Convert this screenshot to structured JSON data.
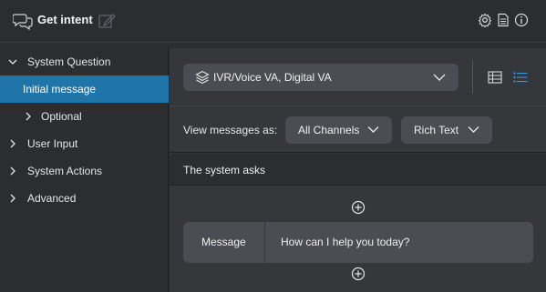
{
  "header": {
    "title": "Get intent",
    "icons": [
      "chat-bubbles-icon",
      "edit-icon",
      "gear-icon",
      "document-icon",
      "info-icon"
    ]
  },
  "sidebar": {
    "items": [
      {
        "label": "System Question",
        "expanded": true
      },
      {
        "label": "Initial message",
        "selected": true
      },
      {
        "label": "Optional",
        "expanded": false
      },
      {
        "label": "User Input",
        "expanded": false
      },
      {
        "label": "System Actions",
        "expanded": false
      },
      {
        "label": "Advanced",
        "expanded": false
      }
    ]
  },
  "main": {
    "environment_select": {
      "value": "IVR/Voice VA, Digital VA"
    },
    "view_toggle": {
      "options": [
        "grid-icon",
        "list-icon"
      ],
      "active": "list-icon"
    },
    "view_messages": {
      "label": "View messages as:",
      "channel_select": "All Channels",
      "format_select": "Rich Text"
    },
    "section": {
      "title": "The system asks"
    },
    "messages": [
      {
        "type": "Message",
        "text": "How can I help you today?"
      }
    ]
  },
  "colors": {
    "background": "#2b2d30",
    "panel": "#35373b",
    "control": "#4a4d52",
    "selected": "#1f75a7",
    "accent": "#2f9be0"
  }
}
